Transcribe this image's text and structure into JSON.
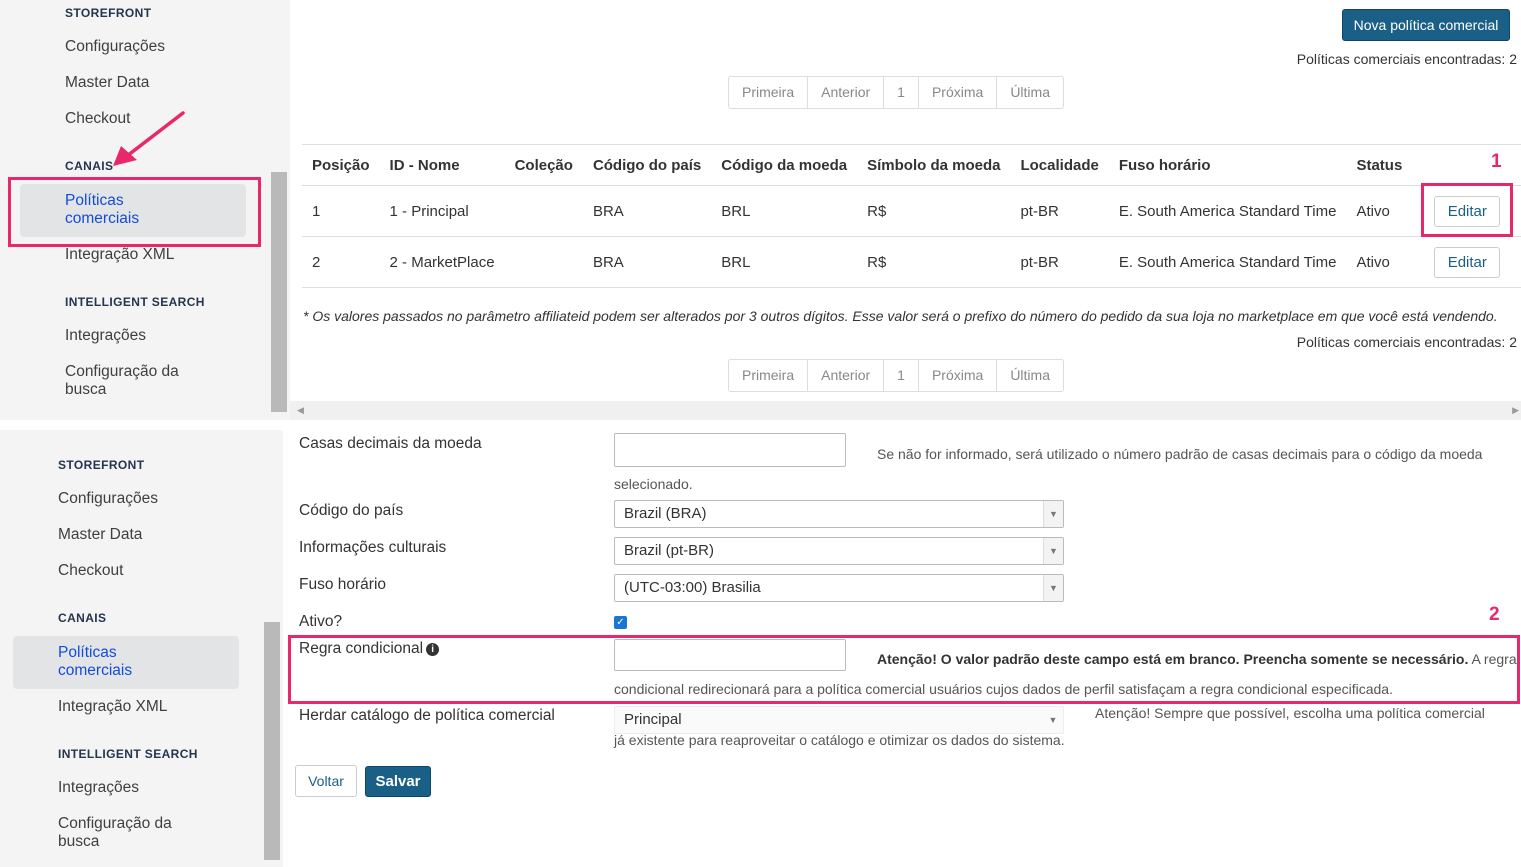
{
  "top_sidebar": {
    "section_storefront": "STOREFRONT",
    "item_configuracoes": "Configurações",
    "item_master_data": "Master Data",
    "item_checkout": "Checkout",
    "section_canais": "CANAIS",
    "item_politicas_l1": "Políticas",
    "item_politicas_l2": "comerciais",
    "item_integracao_xml": "Integração XML",
    "section_intelligent_search": "INTELLIGENT SEARCH",
    "item_integracoes": "Integrações",
    "item_config_busca_l1": "Configuração da",
    "item_config_busca_l2": "busca"
  },
  "bottom_sidebar": {
    "section_storefront": "STOREFRONT",
    "item_configuracoes": "Configurações",
    "item_master_data": "Master Data",
    "item_checkout": "Checkout",
    "section_canais": "CANAIS",
    "item_politicas_l1": "Políticas",
    "item_politicas_l2": "comerciais",
    "item_integracao_xml": "Integração XML",
    "section_intelligent_search": "INTELLIGENT SEARCH",
    "item_integracoes": "Integrações",
    "item_config_busca_l1": "Configuração da",
    "item_config_busca_l2": "busca"
  },
  "list": {
    "new_button": "Nova política comercial",
    "count_label": "Políticas comerciais encontradas: 2",
    "pager": {
      "first": "Primeira",
      "prev": "Anterior",
      "page": "1",
      "next": "Próxima",
      "last": "Última"
    },
    "columns": [
      "Posição",
      "ID - Nome",
      "Coleção",
      "Código do país",
      "Código da moeda",
      "Símbolo da moeda",
      "Localidade",
      "Fuso horário",
      "Status"
    ],
    "rows": [
      {
        "posicao": "1",
        "id_nome": "1 - Principal",
        "colecao": "",
        "pais": "BRA",
        "moeda": "BRL",
        "simbolo": "R$",
        "localidade": "pt-BR",
        "fuso": "E. South America Standard Time",
        "status": "Ativo",
        "action": "Editar"
      },
      {
        "posicao": "2",
        "id_nome": "2 - MarketPlace",
        "colecao": "",
        "pais": "BRA",
        "moeda": "BRL",
        "simbolo": "R$",
        "localidade": "pt-BR",
        "fuso": "E. South America Standard Time",
        "status": "Ativo",
        "action": "Editar"
      }
    ],
    "note": "* Os valores passados no parâmetro affiliateid podem ser alterados por 3 outros dígitos. Esse valor será o prefixo do número do pedido da sua loja no marketplace em que você está vendendo."
  },
  "form": {
    "casas_label": "Casas decimais da moeda",
    "casas_help_1": "Se não for informado, será utilizado o número padrão de casas decimais para o código da moeda",
    "casas_help_2": "selecionado.",
    "pais_label": "Código do país",
    "pais_value": "Brazil (BRA)",
    "cultura_label": "Informações culturais",
    "cultura_value": "Brazil (pt-BR)",
    "fuso_label": "Fuso horário",
    "fuso_value": "(UTC-03:00) Brasilia",
    "ativo_label": "Ativo?",
    "regra_label": "Regra condicional",
    "regra_help_bold": "Atenção! O valor padrão deste campo está em branco. Preencha somente se necessário.",
    "regra_help_1": " A regra",
    "regra_help_2": "condicional redirecionará para a política comercial usuários cujos dados de perfil satisfaçam a regra condicional especificada.",
    "herdar_label": "Herdar catálogo de política comercial",
    "herdar_value": "Principal",
    "herdar_help_1": "Atenção! Sempre que possível, escolha uma política comercial",
    "herdar_help_2": "já existente para reaproveitar o catálogo e otimizar os dados do sistema.",
    "voltar": "Voltar",
    "salvar": "Salvar"
  },
  "annotations": {
    "marker_1": "1",
    "marker_2": "2"
  },
  "colors": {
    "highlight": "#e8286b",
    "primary": "#1a5f86",
    "active_link": "#134cd8"
  }
}
